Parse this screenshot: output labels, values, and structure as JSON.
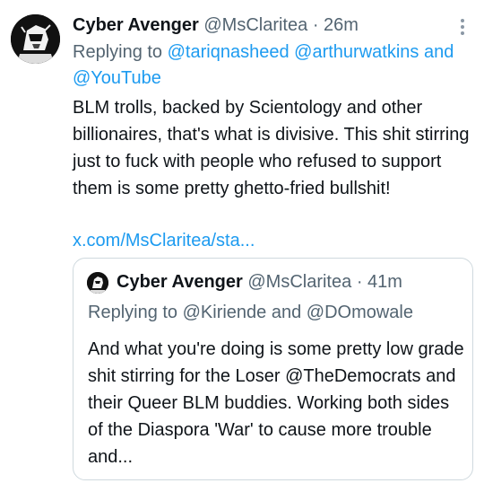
{
  "tweet": {
    "display_name": "Cyber Avenger",
    "handle": "@MsClaritea",
    "separator": "·",
    "time": "26m",
    "replying_prefix": "Replying to",
    "mention_1": "@tariqnasheed",
    "mention_2": "@arthurwatkins",
    "and_word": "and",
    "mention_3": "@YouTube",
    "text": "BLM trolls, backed by Scientology and other billionaires, that's what is divisive. This shit stirring just to fuck with people who refused to support them is some pretty ghetto-fried bullshit!",
    "link": "x.com/MsClaritea/sta..."
  },
  "quote": {
    "display_name": "Cyber Avenger",
    "handle": "@MsClaritea",
    "separator": "·",
    "time": "41m",
    "replying": "Replying to @Kiriende and @DOmowale",
    "text": "And what you're doing is some pretty low grade shit stirring for the Loser @TheDemocrats and their Queer BLM buddies. Working both sides of the Diaspora 'War' to cause more trouble and..."
  },
  "icons": {
    "avatar": "profile-avatar",
    "more": "more-vertical-icon"
  },
  "colors": {
    "link": "#1d9bf0",
    "muted": "#536471",
    "text": "#0f1419",
    "border": "#cfd9de"
  }
}
